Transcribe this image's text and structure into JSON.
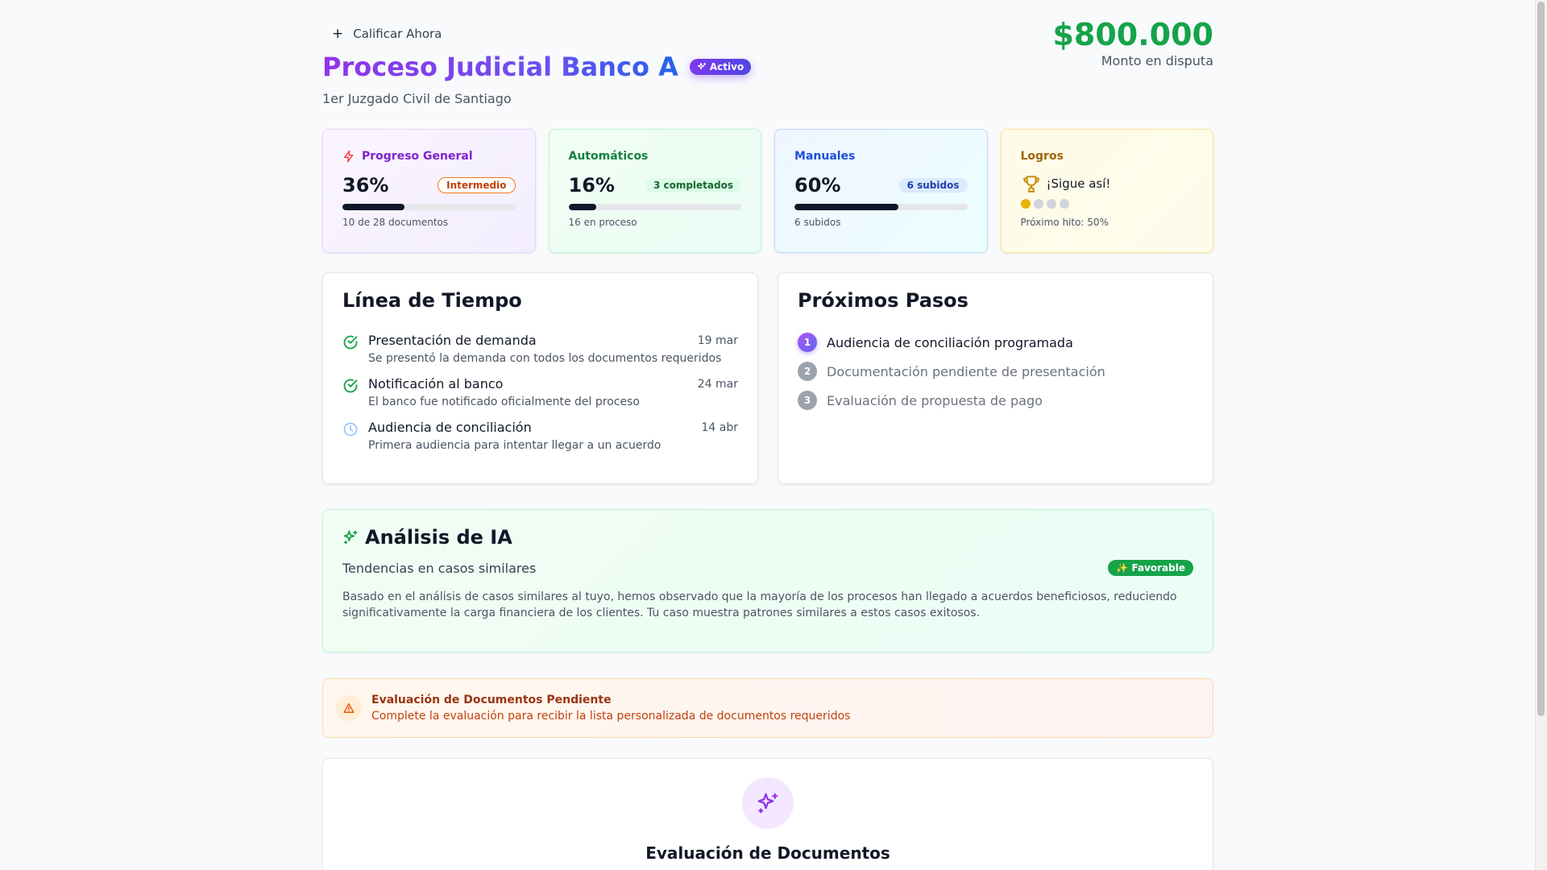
{
  "header": {
    "rate_button": "Calificar Ahora",
    "title": "Proceso Judicial Banco A",
    "status_badge": "Activo",
    "court": "1er Juzgado Civil de Santiago",
    "amount": "$800.000",
    "amount_label": "Monto en disputa"
  },
  "stats": {
    "general": {
      "label": "Progreso General",
      "value": "36%",
      "progress": 36,
      "chip": "Intermedio",
      "footer": "10 de 28 documentos"
    },
    "auto": {
      "label": "Automáticos",
      "value": "16%",
      "progress": 16,
      "chip": "3 completados",
      "footer": "16 en proceso"
    },
    "manual": {
      "label": "Manuales",
      "value": "60%",
      "progress": 60,
      "chip": "6 subidos",
      "footer": "6 subidos"
    },
    "achievements": {
      "label": "Logros",
      "message": "¡Sigue así!",
      "milestones_reached": 1,
      "milestones_total": 4,
      "footer": "Próximo hito: 50%"
    }
  },
  "timeline": {
    "title": "Línea de Tiempo",
    "items": [
      {
        "title": "Presentación de demanda",
        "date": "19 mar",
        "desc": "Se presentó la demanda con todos los documentos requeridos",
        "status": "done"
      },
      {
        "title": "Notificación al banco",
        "date": "24 mar",
        "desc": "El banco fue notificado oficialmente del proceso",
        "status": "done"
      },
      {
        "title": "Audiencia de conciliación",
        "date": "14 abr",
        "desc": "Primera audiencia para intentar llegar a un acuerdo",
        "status": "pending"
      }
    ]
  },
  "next_steps": {
    "title": "Próximos Pasos",
    "items": [
      {
        "num": "1",
        "label": "Audiencia de conciliación programada"
      },
      {
        "num": "2",
        "label": "Documentación pendiente de presentación"
      },
      {
        "num": "3",
        "label": "Evaluación de propuesta de pago"
      }
    ]
  },
  "ai": {
    "title": "Análisis de IA",
    "subtitle": "Tendencias en casos similares",
    "badge": "✨ Favorable",
    "text": "Basado en el análisis de casos similares al tuyo, hemos observado que la mayoría de los procesos han llegado a acuerdos beneficiosos, reduciendo significativamente la carga financiera de los clientes. Tu caso muestra patrones similares a estos casos exitosos."
  },
  "alert": {
    "title": "Evaluación de Documentos Pendiente",
    "text": "Complete la evaluación para recibir la lista personalizada de documentos requeridos"
  },
  "evaluation": {
    "title": "Evaluación de Documentos"
  },
  "colors": {
    "accent_green": "#16a34a",
    "accent_purple": "#9333ea",
    "accent_blue": "#2563eb",
    "warning_orange": "#c2410c",
    "trophy_gold": "#ca8a04"
  }
}
